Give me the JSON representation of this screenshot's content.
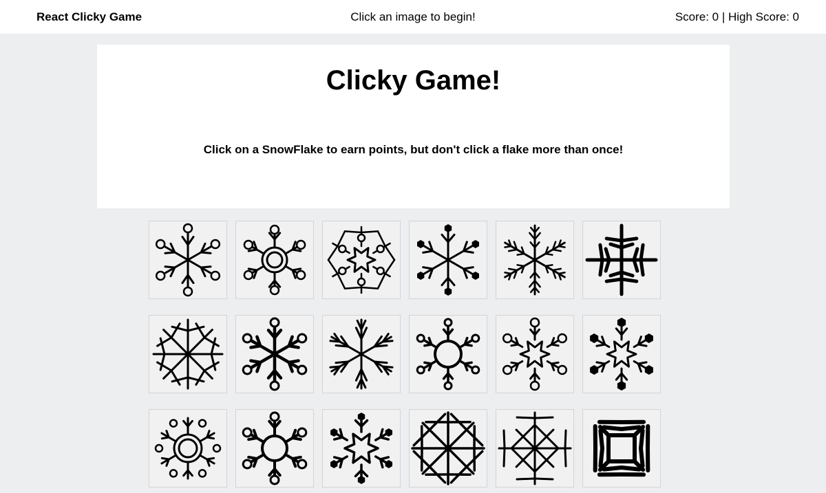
{
  "navbar": {
    "brand": "React Clicky Game",
    "message": "Click an image to begin!",
    "score_text": "Score: 0 | High Score: 0"
  },
  "jumbotron": {
    "title": "Clicky Game!",
    "instructions": "Click on a SnowFlake to earn points, but don't click a flake more than once!"
  },
  "cards": [
    {
      "icon": "snowflake-circle-tips-icon"
    },
    {
      "icon": "snowflake-ring-center-icon"
    },
    {
      "icon": "snowflake-star-hex-icon"
    },
    {
      "icon": "snowflake-hexagon-tips-icon"
    },
    {
      "icon": "snowflake-fern-icon"
    },
    {
      "icon": "snowflake-arrow-cross-icon"
    },
    {
      "icon": "snowflake-eight-point-icon"
    },
    {
      "icon": "snowflake-bold-circle-tips-icon"
    },
    {
      "icon": "snowflake-feather-icon"
    },
    {
      "icon": "snowflake-disc-center-icon"
    },
    {
      "icon": "snowflake-star-circle-tips-icon"
    },
    {
      "icon": "snowflake-star-hexagon-tips-icon"
    },
    {
      "icon": "snowflake-double-ring-icon"
    },
    {
      "icon": "snowflake-disc-circle-tips-icon"
    },
    {
      "icon": "snowflake-star-hex-bold-icon"
    },
    {
      "icon": "snowflake-lattice-icon"
    },
    {
      "icon": "snowflake-diamond-icon"
    },
    {
      "icon": "snowflake-square-chevron-icon"
    }
  ]
}
